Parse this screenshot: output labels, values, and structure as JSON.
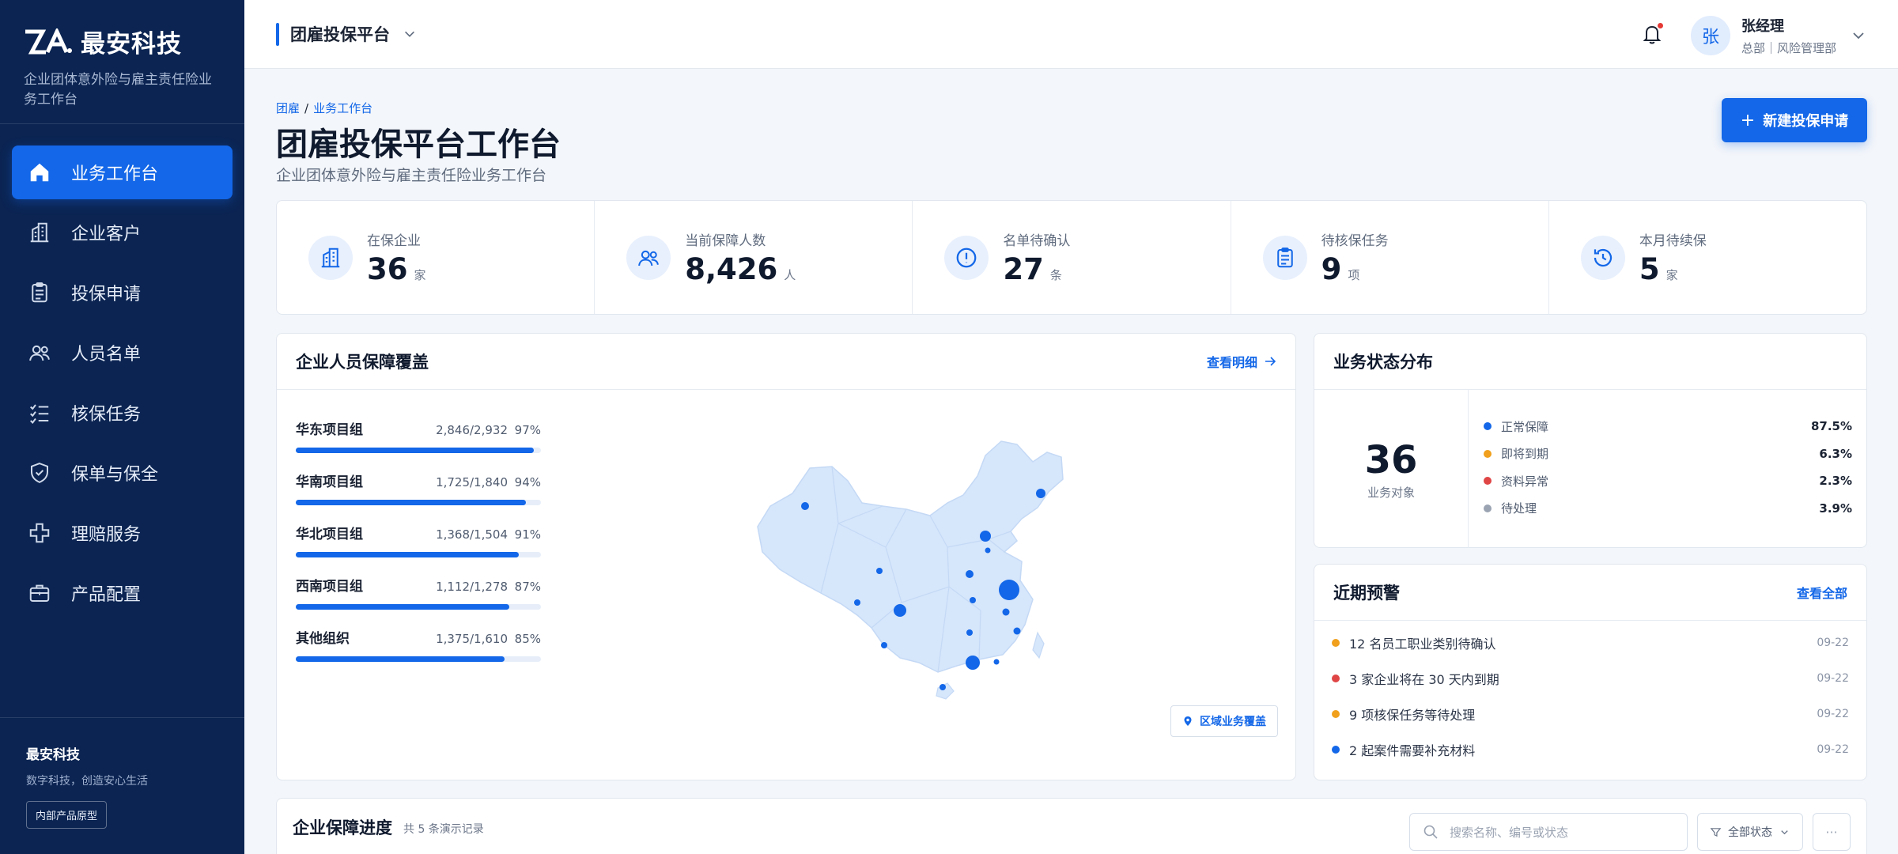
{
  "brand": {
    "name": "最安科技",
    "subtitle": "企业团体意外险与雇主责任险业务工作台"
  },
  "sidebar": {
    "items": [
      {
        "label": "业务工作台",
        "icon": "home-icon",
        "active": true
      },
      {
        "label": "企业客户",
        "icon": "building-icon"
      },
      {
        "label": "投保申请",
        "icon": "clipboard-icon"
      },
      {
        "label": "人员名单",
        "icon": "users-icon"
      },
      {
        "label": "核保任务",
        "icon": "checklist-icon"
      },
      {
        "label": "保单与保全",
        "icon": "shield-check-icon"
      },
      {
        "label": "理赔服务",
        "icon": "medical-cross-icon"
      },
      {
        "label": "产品配置",
        "icon": "briefcase-icon"
      }
    ],
    "footer": {
      "title": "最安科技",
      "subtitle": "数字科技，创造安心生活",
      "badge": "内部产品原型"
    }
  },
  "topbar": {
    "platform": "团雇投保平台",
    "user": {
      "avatar": "张",
      "name": "张经理",
      "role": "总部｜风险管理部"
    }
  },
  "header": {
    "breadcrumb": {
      "root": "团雇",
      "separator": "/",
      "current": "业务工作台"
    },
    "title": "团雇投保平台工作台",
    "subtitle": "企业团体意外险与雇主责任险业务工作台",
    "new_button": "新建投保申请"
  },
  "stats": [
    {
      "label": "在保企业",
      "value": "36",
      "unit": "家",
      "icon": "building-icon"
    },
    {
      "label": "当前保障人数",
      "value": "8,426",
      "unit": "人",
      "icon": "users-icon"
    },
    {
      "label": "名单待确认",
      "value": "27",
      "unit": "条",
      "icon": "alert-circle-icon"
    },
    {
      "label": "待核保任务",
      "value": "9",
      "unit": "项",
      "icon": "clipboard-icon"
    },
    {
      "label": "本月待续保",
      "value": "5",
      "unit": "家",
      "icon": "history-icon"
    }
  ],
  "coverage": {
    "title": "企业人员保障覆盖",
    "link": "查看明细",
    "region_button": "区域业务覆盖",
    "groups": [
      {
        "name": "华东项目组",
        "count": "2,846/2,932",
        "pct": "97%",
        "ratio": 0.97
      },
      {
        "name": "华南项目组",
        "count": "1,725/1,840",
        "pct": "94%",
        "ratio": 0.94
      },
      {
        "name": "华北项目组",
        "count": "1,368/1,504",
        "pct": "91%",
        "ratio": 0.91
      },
      {
        "name": "西南项目组",
        "count": "1,112/1,278",
        "pct": "87%",
        "ratio": 0.87
      },
      {
        "name": "其他组织",
        "count": "1,375/1,610",
        "pct": "85%",
        "ratio": 0.85
      }
    ]
  },
  "status": {
    "title": "业务状态分布",
    "total": "36",
    "caption": "业务对象",
    "items": [
      {
        "label": "正常保障",
        "value": "87.5%",
        "color": "#1367e8"
      },
      {
        "label": "即将到期",
        "value": "6.3%",
        "color": "#f0a01c"
      },
      {
        "label": "资料异常",
        "value": "2.3%",
        "color": "#e04545"
      },
      {
        "label": "待处理",
        "value": "3.9%",
        "color": "#9aa3b2"
      }
    ]
  },
  "alerts": {
    "title": "近期预警",
    "link": "查看全部",
    "items": [
      {
        "text": "12 名员工职业类别待确认",
        "date": "09-22",
        "color": "#f0a01c"
      },
      {
        "text": "3 家企业将在 30 天内到期",
        "date": "09-22",
        "color": "#e04545"
      },
      {
        "text": "9 项核保任务等待处理",
        "date": "09-22",
        "color": "#f0a01c"
      },
      {
        "text": "2 起案件需要补充材料",
        "date": "09-22",
        "color": "#1367e8"
      }
    ]
  },
  "progress": {
    "title": "企业保障进度",
    "count": "共 5 条演示记录",
    "search_placeholder": "搜索名称、编号或状态",
    "filter": "全部状态",
    "more": "···"
  }
}
